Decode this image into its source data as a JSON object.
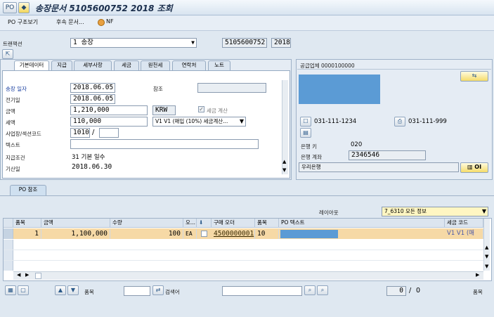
{
  "window": {
    "title": "송장문서 5105600752 2018 조회",
    "menu_icon": "PO",
    "save_icon": "save-icon"
  },
  "toolbar": {
    "po_structure": "PO 구조보기",
    "follow_docs": "후속 문서...",
    "nf": "NF"
  },
  "header": {
    "transaction_label": "트랜잭션",
    "transaction_value": "1 송장",
    "doc_number": "5105600752",
    "fiscal_year": "2018"
  },
  "tabs": [
    "기본데이터",
    "지급",
    "세부사항",
    "세금",
    "원천세",
    "연락처",
    "노트"
  ],
  "basic": {
    "invoice_date_label": "송장 일자",
    "invoice_date": "2018.06.05",
    "reference_label": "참조",
    "reference_value": "",
    "posting_date_label": "전기일",
    "posting_date": "2018.06.05",
    "amount_label": "금액",
    "amount": "1,210,000",
    "currency": "KRW",
    "calc_tax_label": "세금 계산",
    "tax_label": "세액",
    "tax_amount": "110,000",
    "tax_code": "V1 V1 (매입 (10%) 세금계산...",
    "bizplace_label": "사업장/섹션코드",
    "bizplace": "1010",
    "bizplace_sep": "/",
    "bizplace_section": "",
    "text_label": "텍스트",
    "text_value": "",
    "payment_terms_label": "지급조건",
    "payment_terms": "31 기본 일수",
    "base_date_label": "기산일",
    "base_date": "2018.06.30"
  },
  "vendor": {
    "title": "공급업체 0000100000",
    "phone": "031-111-1234",
    "fax": "031-111-999",
    "bank_key_label": "은행 키",
    "bank_key": "020",
    "bank_account_label": "은행 계좌",
    "bank_account": "2346546",
    "bank_name": "우리은행",
    "oi_button": "OI"
  },
  "po": {
    "tab_label": "PO 참조",
    "layout_label": "레이아웃",
    "layout_value": "7_6310 모든 정보",
    "columns": [
      "품목",
      "금액",
      "수량",
      "오...",
      "",
      "구매 오더",
      "품목",
      "PO 텍스트",
      "세금 코드"
    ],
    "rows": [
      {
        "item": "1",
        "amount": "1,100,000",
        "qty": "100",
        "unit": "EA",
        "po": "4500000001",
        "po_item": "10",
        "po_text": "",
        "tax_code": "V1 V1 (매"
      }
    ]
  },
  "bottom": {
    "item_label": "품목",
    "item_value": "",
    "search_label": "검색어",
    "search_value": "",
    "count_current": "0",
    "count_sep": "/",
    "count_total": "0",
    "right_label": "품목"
  },
  "colors": {
    "selected_row": "#f6d9a6",
    "blue_block": "#5b9bd5",
    "label_blue": "#1a3fa0"
  }
}
